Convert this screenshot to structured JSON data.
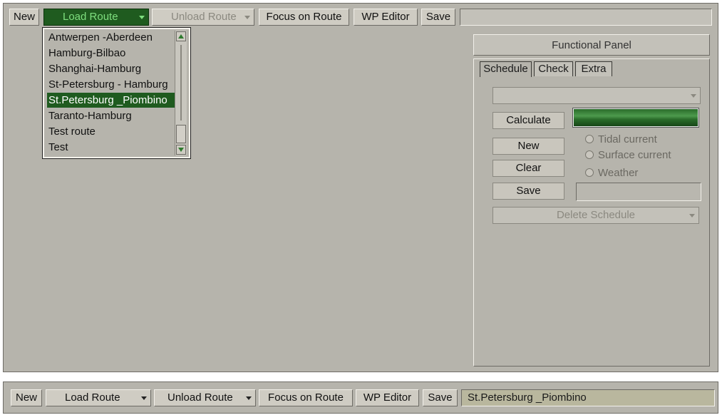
{
  "toolbar_top": {
    "new_label": "New",
    "load_route_label": "Load Route",
    "unload_route_label": "Unload Route",
    "focus_label": "Focus on Route",
    "wp_editor_label": "WP Editor",
    "save_label": "Save",
    "route_field_value": ""
  },
  "route_list": {
    "items": [
      "Antwerpen -Aberdeen",
      "Hamburg-Bilbao",
      "Shanghai-Hamburg",
      "St-Petersburg - Hamburg",
      "St.Petersburg _Piombino",
      "Taranto-Hamburg",
      "Test route",
      "Test"
    ],
    "selected_index": 4
  },
  "functional_panel": {
    "title": "Functional Panel",
    "tabs": [
      "Schedule",
      "Check",
      "Extra"
    ],
    "active_tab": "Schedule",
    "schedule_select_value": "",
    "calculate_label": "Calculate",
    "new_label": "New",
    "clear_label": "Clear",
    "save_label": "Save",
    "save_field_value": "",
    "progress_fraction": 1.0,
    "radio_options": [
      "Tidal current",
      "Surface current",
      "Weather"
    ],
    "delete_schedule_label": "Delete Schedule"
  },
  "toolbar_bottom": {
    "new_label": "New",
    "load_route_label": "Load Route",
    "unload_route_label": "Unload Route",
    "focus_label": "Focus on Route",
    "wp_editor_label": "WP Editor",
    "save_label": "Save",
    "route_field_value": "St.Petersburg _Piombino"
  },
  "colors": {
    "panel_bg": "#b6b4ac",
    "accent_green": "#1f5b1f",
    "progress_green": "#3f8a3f"
  }
}
